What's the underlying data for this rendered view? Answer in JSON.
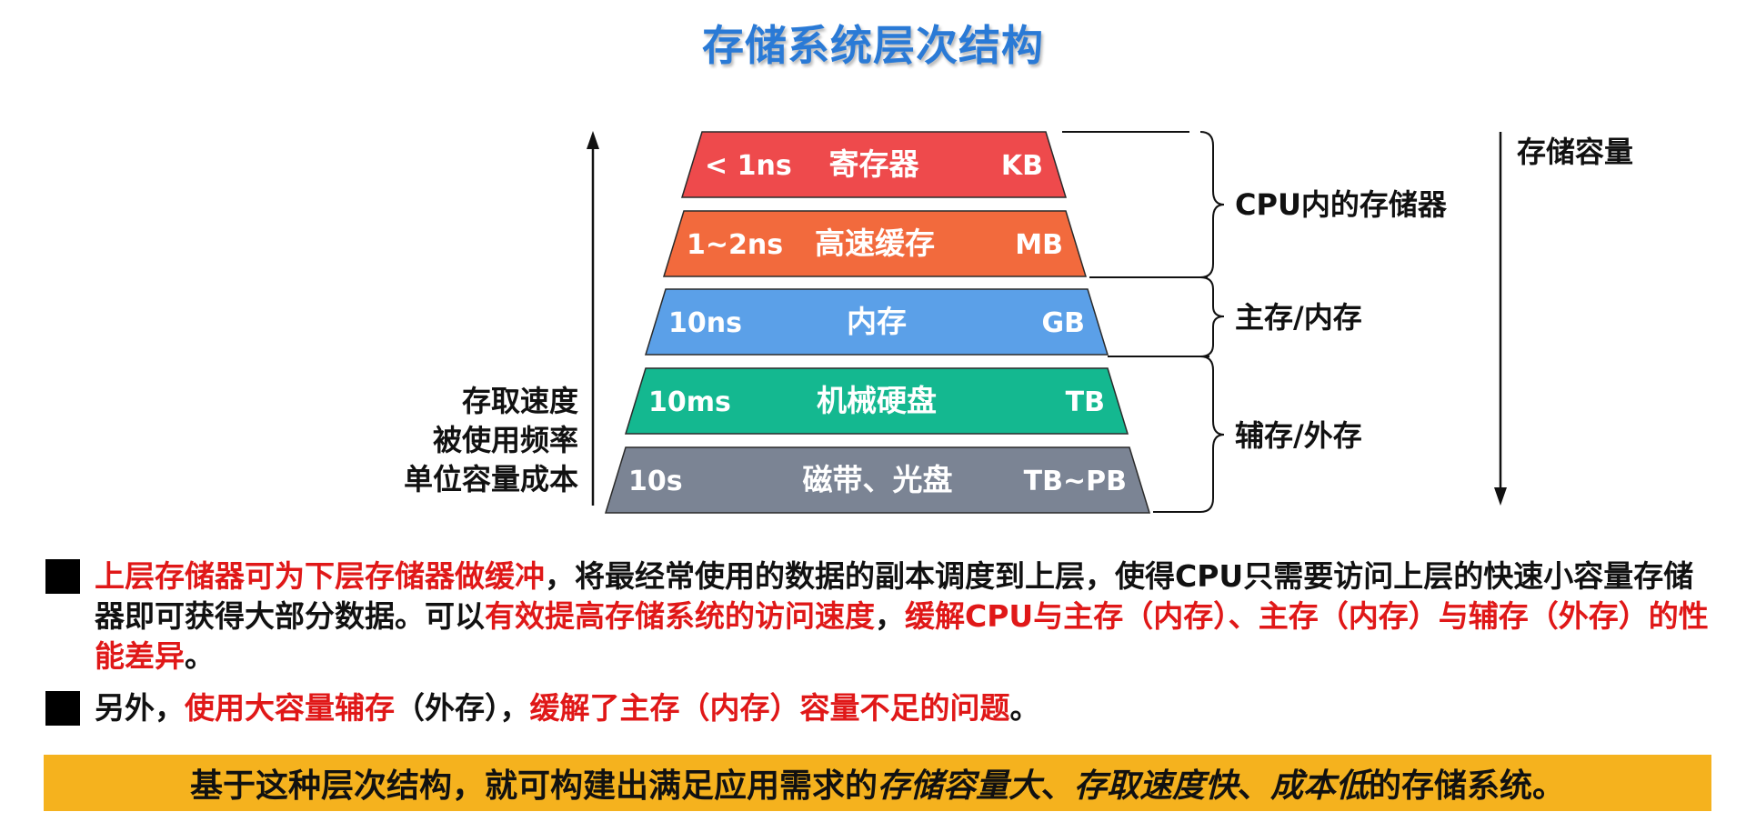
{
  "title": "存储系统层次结构",
  "hierarchy": {
    "levels": [
      {
        "speed": "< 1ns",
        "name": "寄存器",
        "capacity": "KB",
        "color": "#ee4a4c"
      },
      {
        "speed": "1~2ns",
        "name": "高速缓存",
        "capacity": "MB",
        "color": "#f26a3d"
      },
      {
        "speed": "10ns",
        "name": "内存",
        "capacity": "GB",
        "color": "#5ba0e8"
      },
      {
        "speed": "10ms",
        "name": "机械硬盘",
        "capacity": "TB",
        "color": "#14b890"
      },
      {
        "speed": "10s",
        "name": "磁带、光盘",
        "capacity": "TB~PB",
        "color": "#7b8494"
      }
    ],
    "left_axis": [
      "存取速度",
      "被使用频率",
      "单位容量成本"
    ],
    "right_axis": "存储容量",
    "groups": [
      "CPU内的存储器",
      "主存/内存",
      "辅存/外存"
    ]
  },
  "paragraphs": {
    "p1": {
      "s1": "上层存储器可为下层存储器做缓冲",
      "s2": "，将最经常使用的数据的副本调度到上层，使得CPU只需要访问上层的快速小容量存储器即可获得大部分数据。可以",
      "s3": "有效提高存储系统的访问速度",
      "s4": "，",
      "s5": "缓解CPU与主存（内存）、主存（内存）与辅存（外存）的性能差异",
      "s6": "。"
    },
    "p2": {
      "s1": "另外，",
      "s2": "使用大容量辅存",
      "s3": "（外存），",
      "s4": "缓解了主存（内存）容量不足的问题",
      "s5": "。"
    }
  },
  "banner": {
    "s1": "基于这种层次结构，就可构建出满足应用需求的 ",
    "s2": "存储容量大",
    "s3": "、",
    "s4": "存取速度快",
    "s5": "、",
    "s6": "成本低",
    "s7": "的存储系统。"
  }
}
